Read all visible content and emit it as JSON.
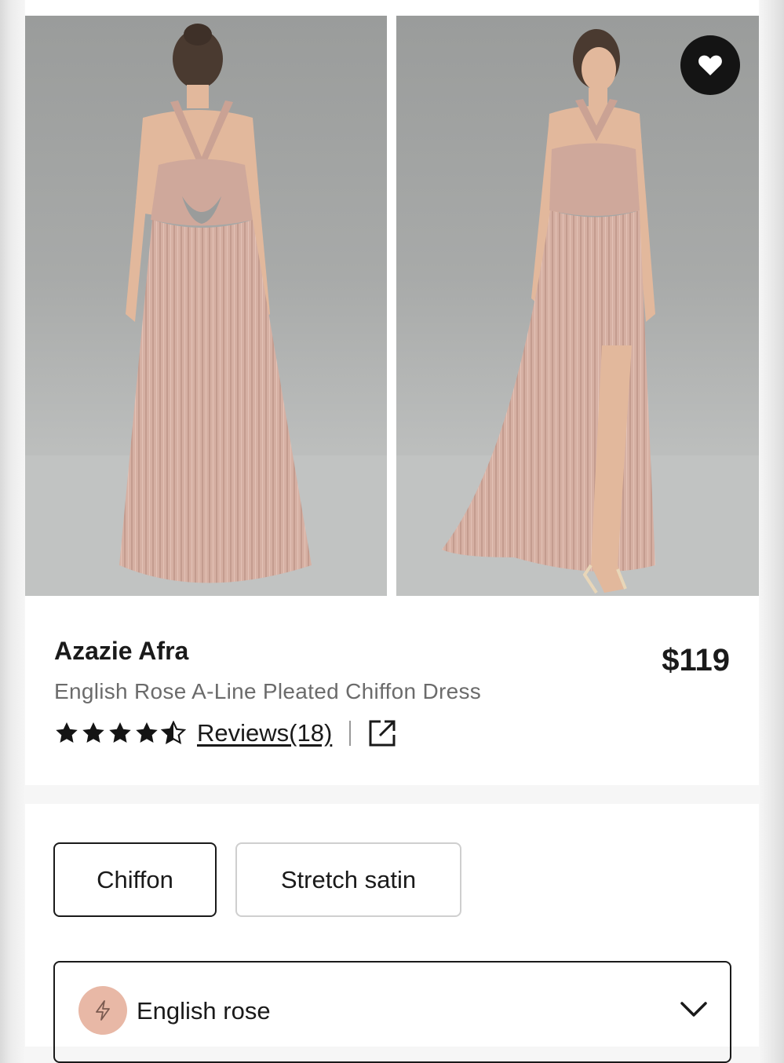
{
  "product": {
    "brand": "Azazie Afra",
    "name": "English Rose A-Line Pleated Chiffon Dress",
    "price": "$119",
    "rating": 4.5,
    "rating_max": 5,
    "reviews_label": "Reviews(18)"
  },
  "gallery": {
    "images": [
      {
        "icon": "dress-back-view"
      },
      {
        "icon": "dress-front-view"
      }
    ],
    "wishlist_icon": "heart-icon"
  },
  "options": {
    "fabrics": [
      {
        "label": "Chiffon",
        "selected": true
      },
      {
        "label": "Stretch satin",
        "selected": false
      }
    ],
    "color": {
      "label": "English rose",
      "swatch_color": "#e8b8a6",
      "swatch_icon": "lightning-icon",
      "dropdown_icon": "chevron-down-icon"
    }
  },
  "colors": {
    "dress": "#d6b0a3",
    "text_primary": "#1a1a1a",
    "text_secondary": "#6b6b6b",
    "wishlist_bg": "#141414"
  }
}
